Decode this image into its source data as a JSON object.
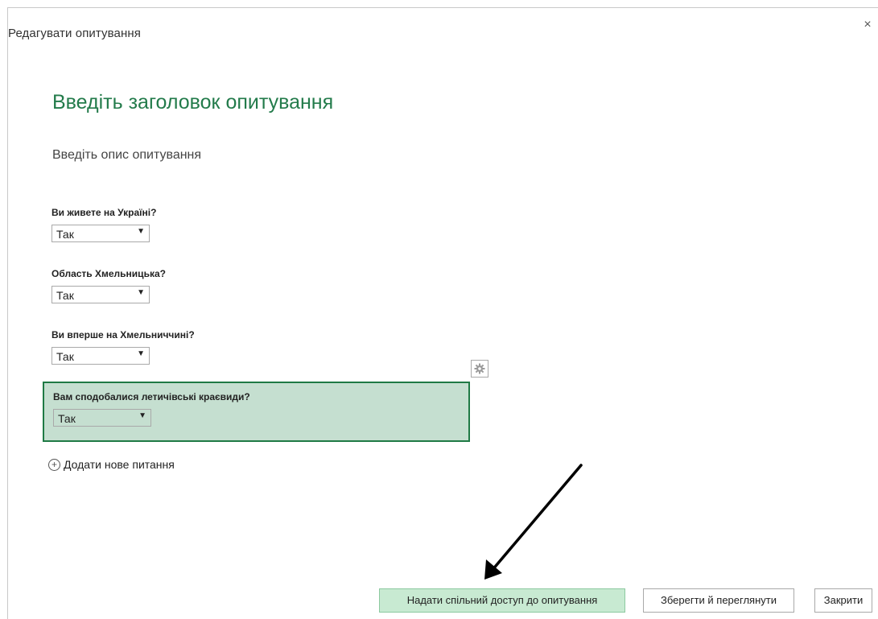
{
  "dialog": {
    "title": "Редагувати опитування",
    "close_label": "×"
  },
  "survey": {
    "title": "Введіть заголовок опитування",
    "description": "Введіть опис опитування"
  },
  "questions": [
    {
      "label": "Ви живете на Україні?",
      "answer": "Так"
    },
    {
      "label": "Область Хмельницька?",
      "answer": "Так"
    },
    {
      "label": "Ви вперше на Хмельниччині?",
      "answer": "Так"
    },
    {
      "label": "Вам сподобалися летичівські краєвиди?",
      "answer": "Так"
    }
  ],
  "add_question_label": "Додати нове питання",
  "footer": {
    "share_label": "Надати спільний доступ до опитування",
    "save_view_label": "Зберегти й переглянути",
    "close_label": "Закрити"
  },
  "colors": {
    "accent": "#237b4b",
    "selected_bg": "#c5dfd0",
    "primary_btn_bg": "#c8ead2"
  },
  "icons": {
    "settings": "gear-icon",
    "add": "plus-circle-icon",
    "annotation": "arrow-annotation"
  }
}
